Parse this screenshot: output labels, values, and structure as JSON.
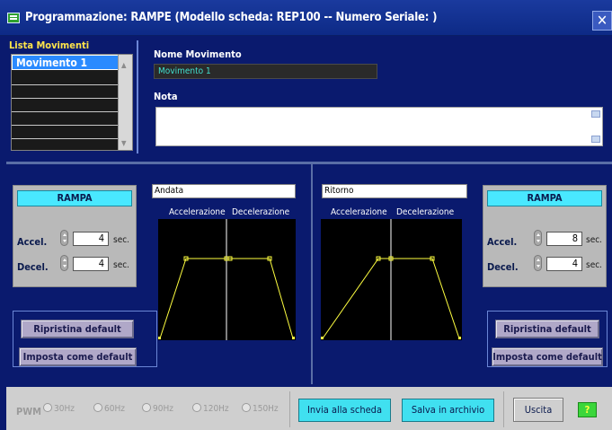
{
  "window": {
    "title": "Programmazione: RAMPE (Modello scheda: REP100 -- Numero Seriale: )"
  },
  "lista_movimenti": {
    "title": "Lista Movimenti",
    "items": [
      "Movimento 1",
      "",
      "",
      "",
      "",
      "",
      ""
    ],
    "selected": "Movimento 1"
  },
  "nome_movimento": {
    "label": "Nome Movimento",
    "value": "Movimento 1"
  },
  "nota": {
    "label": "Nota",
    "value": ""
  },
  "andata": {
    "title": "Andata",
    "accel_label": "Accelerazione",
    "decel_label": "Decelerazione",
    "rampa": {
      "header": "RAMPA",
      "accel_label": "Accel.",
      "accel_value": "4",
      "decel_label": "Decel.",
      "decel_value": "4",
      "unit": "sec."
    },
    "buttons": {
      "ripristina": "Ripristina default",
      "imposta": "Imposta come default"
    }
  },
  "ritorno": {
    "title": "Ritorno",
    "accel_label": "Accelerazione",
    "decel_label": "Decelerazione",
    "rampa": {
      "header": "RAMPA",
      "accel_label": "Accel.",
      "accel_value": "8",
      "decel_label": "Decel.",
      "decel_value": "4",
      "unit": "sec."
    },
    "buttons": {
      "ripristina": "Ripristina default",
      "imposta": "Imposta come default"
    }
  },
  "bottom": {
    "pwm_label": "PWM",
    "pwm_options": [
      "30Hz",
      "60Hz",
      "90Hz",
      "120Hz",
      "150Hz"
    ],
    "invia": "Invia alla scheda",
    "salva": "Salva in archivio",
    "uscita": "Uscita",
    "help": "?"
  },
  "colors": {
    "background": "#0a1a6e",
    "accent_cyan": "#40e0f0",
    "label_yellow": "#ffe54a",
    "ramp_line": "#ffff40"
  }
}
